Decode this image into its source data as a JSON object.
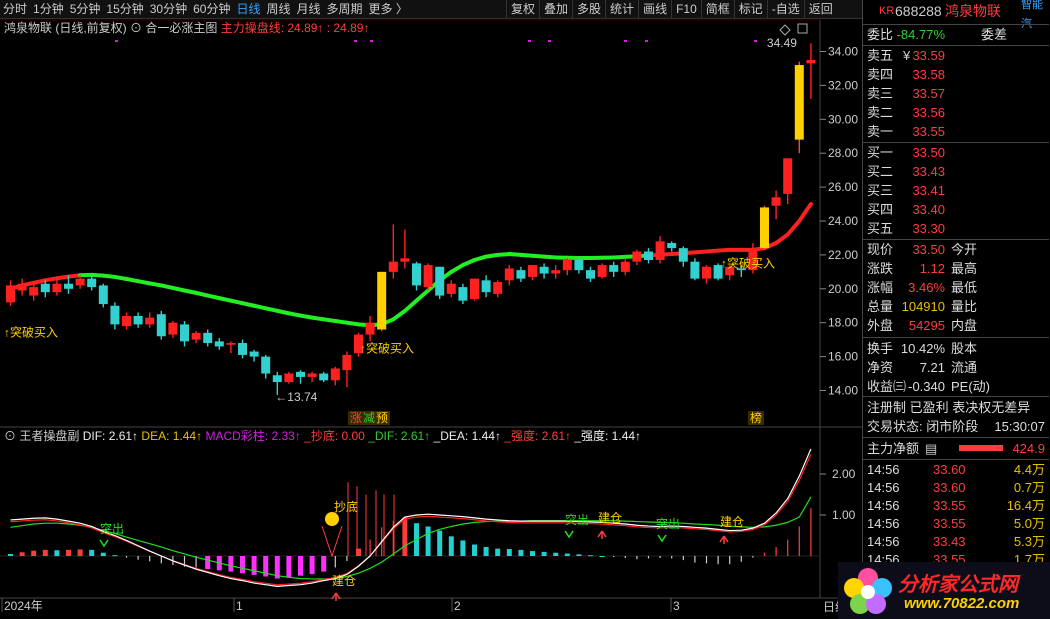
{
  "toolbar": {
    "periods": [
      "分时",
      "1分钟",
      "5分钟",
      "15分钟",
      "30分钟",
      "60分钟",
      "日线",
      "周线",
      "月线",
      "多周期",
      "更多 〉"
    ],
    "active": "日线",
    "buttons": [
      "复权",
      "叠加",
      "多股",
      "统计",
      "画线",
      "F10",
      "简框",
      "标记",
      "-自选",
      "返回"
    ]
  },
  "main_title": {
    "stock": "鸿泉物联 (日线,前复权)",
    "indicator": "合一必涨主图",
    "line_label": "主力操盘线: 24.89↑",
    "line_value": ": 24.89↑"
  },
  "sub_title": {
    "name": "王者操盘副",
    "dif": "DIF: 2.61↑",
    "dea": "DEA: 1.44↑",
    "macd": "MACD彩柱: 2.33↑",
    "chaodi": "_抄底: 0.00",
    "dif2": "_DIF: 2.61↑",
    "dea2": "_DEA: 1.44↑",
    "qiangdu": "_强度: 2.61↑",
    "qiangdu2": "_强度: 1.44↑"
  },
  "chart_data": {
    "type": "candlestick",
    "price_ticks": [
      "34.00",
      "32.00",
      "30.00",
      "28.00",
      "26.00",
      "24.00",
      "22.00",
      "20.00",
      "18.00",
      "16.00",
      "14.00"
    ],
    "macd_ticks": [
      "2.00",
      "1.00"
    ],
    "x_labels": [
      "2024年",
      "1",
      "2",
      "3"
    ],
    "annotations": {
      "high": "34.49",
      "low": "←13.74",
      "buy": "↑突破买入",
      "chaodi": "抄底",
      "jiancang": "建仓",
      "tuchu": "突出",
      "zhang": "涨",
      "jian": "减",
      "yu": "预",
      "bang": "榜"
    },
    "candles": [
      [
        19.2,
        20.2,
        19.0,
        20.5
      ],
      [
        19.9,
        20.3,
        19.6,
        20.6
      ],
      [
        19.6,
        20.1,
        19.3,
        20.3
      ],
      [
        20.3,
        19.8,
        19.5,
        20.5
      ],
      [
        19.8,
        20.3,
        19.6,
        20.6
      ],
      [
        20.3,
        20.0,
        19.7,
        20.8
      ],
      [
        20.2,
        20.6,
        20.0,
        20.8
      ],
      [
        20.6,
        20.1,
        19.9,
        20.8
      ],
      [
        20.2,
        19.1,
        18.9,
        20.3
      ],
      [
        19.0,
        17.9,
        17.6,
        19.2
      ],
      [
        17.8,
        18.4,
        17.6,
        18.6
      ],
      [
        18.4,
        17.9,
        17.7,
        18.6
      ],
      [
        17.9,
        18.3,
        17.7,
        18.6
      ],
      [
        18.5,
        17.2,
        17.0,
        18.7
      ],
      [
        17.3,
        18.0,
        17.1,
        18.1
      ],
      [
        17.9,
        16.9,
        16.6,
        18.1
      ],
      [
        17.0,
        17.4,
        16.8,
        17.5
      ],
      [
        17.4,
        16.8,
        16.6,
        17.6
      ],
      [
        16.9,
        16.6,
        16.4,
        17.1
      ],
      [
        16.7,
        16.8,
        16.2,
        16.9
      ],
      [
        16.8,
        16.1,
        15.9,
        17.0
      ],
      [
        16.3,
        16.0,
        15.7,
        16.4
      ],
      [
        16.0,
        15.0,
        14.7,
        16.1
      ],
      [
        14.9,
        14.5,
        13.74,
        15.1
      ],
      [
        14.5,
        15.0,
        14.4,
        15.1
      ],
      [
        15.1,
        14.8,
        14.4,
        15.2
      ],
      [
        14.8,
        15.0,
        14.5,
        15.1
      ],
      [
        15.0,
        14.6,
        14.5,
        15.1
      ],
      [
        14.6,
        15.3,
        14.3,
        15.4
      ],
      [
        15.2,
        16.1,
        14.2,
        16.3
      ],
      [
        16.2,
        17.3,
        16.0,
        17.4
      ],
      [
        17.3,
        18.0,
        16.9,
        18.4
      ],
      [
        17.6,
        21.0,
        17.5,
        21.0
      ],
      [
        21.0,
        21.6,
        20.6,
        23.8
      ],
      [
        21.6,
        21.8,
        21.2,
        23.5
      ],
      [
        21.5,
        20.2,
        19.9,
        21.6
      ],
      [
        20.1,
        21.4,
        19.9,
        21.5
      ],
      [
        21.3,
        19.6,
        19.4,
        21.3
      ],
      [
        19.7,
        20.3,
        19.5,
        20.5
      ],
      [
        20.1,
        19.3,
        19.1,
        20.3
      ],
      [
        19.4,
        20.6,
        19.3,
        20.6
      ],
      [
        20.5,
        19.8,
        19.5,
        20.8
      ],
      [
        19.7,
        20.4,
        19.5,
        20.5
      ],
      [
        20.5,
        21.2,
        20.2,
        21.4
      ],
      [
        21.1,
        20.6,
        20.4,
        21.3
      ],
      [
        20.7,
        21.4,
        20.5,
        21.4
      ],
      [
        21.3,
        20.9,
        20.6,
        21.5
      ],
      [
        20.9,
        21.1,
        20.6,
        21.4
      ],
      [
        21.1,
        21.7,
        20.8,
        21.8
      ],
      [
        21.7,
        21.1,
        20.9,
        21.8
      ],
      [
        21.1,
        20.6,
        20.4,
        21.3
      ],
      [
        20.7,
        21.4,
        20.6,
        21.5
      ],
      [
        21.4,
        21.0,
        20.7,
        21.6
      ],
      [
        21.0,
        21.6,
        20.8,
        21.8
      ],
      [
        21.6,
        22.2,
        21.4,
        22.3
      ],
      [
        22.2,
        21.7,
        21.5,
        22.4
      ],
      [
        21.7,
        22.8,
        21.5,
        23.1
      ],
      [
        22.7,
        22.4,
        22.2,
        22.8
      ],
      [
        22.4,
        21.6,
        21.3,
        22.5
      ],
      [
        21.6,
        20.6,
        20.5,
        21.8
      ],
      [
        20.6,
        21.3,
        20.3,
        21.4
      ],
      [
        21.4,
        20.6,
        20.5,
        21.5
      ],
      [
        20.8,
        21.3,
        20.5,
        21.4
      ],
      [
        21.2,
        21.1,
        20.7,
        21.4
      ],
      [
        21.1,
        22.3,
        20.9,
        22.7
      ],
      [
        22.4,
        24.8,
        22.3,
        24.9
      ],
      [
        24.9,
        25.4,
        24.1,
        25.8
      ],
      [
        25.6,
        27.7,
        25.0,
        27.7
      ],
      [
        28.8,
        33.2,
        28.0,
        33.4
      ],
      [
        33.3,
        33.5,
        31.2,
        34.49
      ]
    ],
    "line": [
      20.0,
      20.2,
      20.35,
      20.5,
      20.62,
      20.72,
      20.8,
      20.82,
      20.78,
      20.7,
      20.58,
      20.45,
      20.32,
      20.2,
      20.05,
      19.9,
      19.76,
      19.6,
      19.45,
      19.3,
      19.15,
      19.0,
      18.85,
      18.7,
      18.55,
      18.42,
      18.3,
      18.2,
      18.1,
      18.0,
      17.9,
      17.85,
      17.9,
      18.2,
      18.7,
      19.3,
      19.9,
      20.5,
      21.0,
      21.4,
      21.7,
      21.9,
      22.0,
      22.05,
      22.0,
      21.95,
      21.9,
      21.85,
      21.83,
      21.82,
      21.82,
      21.83,
      21.85,
      21.88,
      21.92,
      21.97,
      22.0,
      22.05,
      22.1,
      22.15,
      22.2,
      22.25,
      22.3,
      22.3,
      22.3,
      22.4,
      22.7,
      23.2,
      24.0,
      25.0
    ],
    "macd": [
      0.05,
      0.09,
      0.13,
      0.15,
      0.14,
      0.15,
      0.16,
      0.15,
      0.08,
      0.02,
      -0.04,
      -0.09,
      -0.13,
      -0.18,
      -0.22,
      -0.26,
      -0.28,
      -0.32,
      -0.35,
      -0.38,
      -0.42,
      -0.46,
      -0.5,
      -0.55,
      -0.53,
      -0.48,
      -0.44,
      -0.38,
      -0.28,
      -0.12,
      0.18,
      0.4,
      0.7,
      0.86,
      0.94,
      0.8,
      0.72,
      0.62,
      0.48,
      0.38,
      0.28,
      0.22,
      0.18,
      0.17,
      0.15,
      0.12,
      0.1,
      0.08,
      0.06,
      0.04,
      0.02,
      0.0,
      -0.02,
      -0.05,
      -0.08,
      -0.06,
      -0.05,
      -0.06,
      -0.1,
      -0.16,
      -0.18,
      -0.2,
      -0.2,
      -0.14,
      -0.04,
      0.08,
      0.22,
      0.4,
      0.72,
      1.17
    ],
    "dif": [
      0.88,
      0.9,
      0.92,
      0.93,
      0.9,
      0.85,
      0.8,
      0.72,
      0.6,
      0.5,
      0.38,
      0.25,
      0.12,
      0.0,
      -0.12,
      -0.22,
      -0.32,
      -0.4,
      -0.48,
      -0.55,
      -0.6,
      -0.66,
      -0.7,
      -0.74,
      -0.72,
      -0.7,
      -0.66,
      -0.6,
      -0.55,
      -0.45,
      -0.25,
      0.0,
      0.35,
      0.7,
      0.95,
      1.0,
      1.02,
      1.0,
      0.98,
      0.96,
      0.93,
      0.9,
      0.88,
      0.86,
      0.85,
      0.85,
      0.85,
      0.85,
      0.85,
      0.84,
      0.83,
      0.82,
      0.8,
      0.78,
      0.75,
      0.73,
      0.72,
      0.73,
      0.72,
      0.7,
      0.68,
      0.65,
      0.62,
      0.63,
      0.68,
      0.8,
      1.05,
      1.4,
      1.95,
      2.61
    ],
    "dea": [
      0.7,
      0.74,
      0.78,
      0.8,
      0.8,
      0.78,
      0.75,
      0.7,
      0.62,
      0.55,
      0.46,
      0.38,
      0.3,
      0.22,
      0.13,
      0.05,
      -0.03,
      -0.1,
      -0.17,
      -0.24,
      -0.3,
      -0.36,
      -0.42,
      -0.48,
      -0.52,
      -0.55,
      -0.56,
      -0.56,
      -0.55,
      -0.5,
      -0.42,
      -0.3,
      -0.15,
      0.05,
      0.25,
      0.4,
      0.55,
      0.65,
      0.72,
      0.78,
      0.82,
      0.84,
      0.85,
      0.85,
      0.85,
      0.86,
      0.86,
      0.86,
      0.86,
      0.86,
      0.86,
      0.86,
      0.86,
      0.85,
      0.84,
      0.83,
      0.82,
      0.81,
      0.8,
      0.78,
      0.77,
      0.75,
      0.73,
      0.71,
      0.7,
      0.71,
      0.75,
      0.82,
      0.95,
      1.44
    ]
  },
  "quote": {
    "code": "688288",
    "name": "鸿泉物联",
    "kr": "KR",
    "tag": "智能汽",
    "weibi_label": "委比",
    "weibi": "-84.77%",
    "weicha_label": "委差",
    "asks": [
      {
        "l": "卖五",
        "p": "33.59",
        "f": "¥"
      },
      {
        "l": "卖四",
        "p": "33.58"
      },
      {
        "l": "卖三",
        "p": "33.57"
      },
      {
        "l": "卖二",
        "p": "33.56"
      },
      {
        "l": "卖一",
        "p": "33.55"
      }
    ],
    "bids": [
      {
        "l": "买一",
        "p": "33.50"
      },
      {
        "l": "买二",
        "p": "33.43"
      },
      {
        "l": "买三",
        "p": "33.41"
      },
      {
        "l": "买四",
        "p": "33.40"
      },
      {
        "l": "买五",
        "p": "33.30"
      }
    ],
    "stats": [
      {
        "l": "现价",
        "v": "33.50",
        "c": "今开",
        "col": "#ff3c3c"
      },
      {
        "l": "涨跌",
        "v": "1.12",
        "c": "最高",
        "col": "#ff3c3c"
      },
      {
        "l": "涨幅",
        "v": "3.46%",
        "c": "最低",
        "col": "#ff3c3c"
      },
      {
        "l": "总量",
        "v": "104910",
        "c": "量比",
        "col": "#e8c000"
      },
      {
        "l": "外盘",
        "v": "54295",
        "c": "内盘",
        "col": "#ff3c3c"
      }
    ],
    "stats2": [
      {
        "l": "换手",
        "v": "10.42%",
        "c": "股本"
      },
      {
        "l": "净资",
        "v": "7.21",
        "c": "流通"
      },
      {
        "l": "收益㈢",
        "v": "-0.340",
        "c": "PE(动)"
      }
    ],
    "tags": "注册制 已盈利 表决权无差异",
    "status_label": "交易状态: 闭市阶段",
    "status_time": "15:30:07",
    "zl_label": "主力净额",
    "zl_value": "424.9",
    "trades": [
      {
        "t": "14:56",
        "p": "33.60",
        "q": "4.4万"
      },
      {
        "t": "14:56",
        "p": "33.60",
        "q": "0.7万"
      },
      {
        "t": "14:56",
        "p": "33.55",
        "q": "16.4万"
      },
      {
        "t": "14:56",
        "p": "33.55",
        "q": "5.0万"
      },
      {
        "t": "14:56",
        "p": "33.43",
        "q": "5.3万"
      },
      {
        "t": "14:56",
        "p": "33.55",
        "q": "1.7万"
      }
    ],
    "ri": "日线"
  },
  "watermark": {
    "title": "分析家公式网",
    "url": "www.70822.com"
  }
}
